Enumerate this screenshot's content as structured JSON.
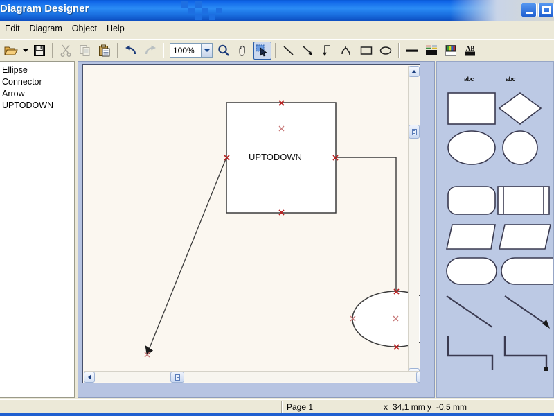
{
  "window": {
    "title": "Diagram Designer",
    "buttons": [
      {
        "name": "minimize",
        "glyph": "minimize-icon"
      },
      {
        "name": "maximize",
        "glyph": "maximize-icon"
      }
    ]
  },
  "menubar": {
    "items": [
      {
        "label": "Edit"
      },
      {
        "label": "Diagram"
      },
      {
        "label": "Object"
      },
      {
        "label": "Help"
      }
    ]
  },
  "toolbar": {
    "open_label": "open-folder-icon",
    "open_dropdown_label": "dropdown-arrow-icon",
    "save_label": "save-icon",
    "cut_label": "cut-icon",
    "copy_label": "copy-icon",
    "paste_label": "paste-icon",
    "undo_label": "undo-icon",
    "redo_label": "redo-icon",
    "zoom": {
      "value": "100%",
      "placeholder": "100%"
    },
    "magnifier_label": "magnifier-icon",
    "pan_label": "hand-icon",
    "select_label": "select-pointer-icon",
    "line_label": "line-icon",
    "arrow_label": "arrow-icon",
    "elbow_label": "elbow-connector-icon",
    "polyline_label": "polyline-connector-icon",
    "rect_label": "rectangle-icon",
    "ellipse_label": "ellipse-icon",
    "linewidth_label": "line-width-icon",
    "linestyle_label": "line-style-icon",
    "fillcolor_label": "fill-color-icon",
    "font_label": "font-icon"
  },
  "object_list": {
    "items": [
      {
        "label": "Ellipse"
      },
      {
        "label": "Connector"
      },
      {
        "label": "Arrow"
      },
      {
        "label": "UPTODOWN"
      }
    ]
  },
  "canvas": {
    "shapes": {
      "rectangle_label": "UPTODOWN"
    },
    "vscroll": {
      "up_label": "scroll-up-icon",
      "down_label": "scroll-down-icon"
    },
    "hscroll": {
      "left_label": "scroll-left-icon",
      "right_label": "scroll-right-icon"
    }
  },
  "palette": {
    "text_labels": [
      {
        "label": "abc"
      },
      {
        "label": "abc"
      }
    ],
    "shapes": [
      {
        "name": "rectangle"
      },
      {
        "name": "diamond"
      },
      {
        "name": "ellipse"
      },
      {
        "name": "circle"
      },
      {
        "name": "rounded-rectangle"
      },
      {
        "name": "predefined-process"
      },
      {
        "name": "trapezoid-down"
      },
      {
        "name": "parallelogram"
      },
      {
        "name": "stadium"
      },
      {
        "name": "delay"
      },
      {
        "name": "line"
      },
      {
        "name": "arrow"
      },
      {
        "name": "elbow-connector"
      },
      {
        "name": "elbow-arrow-connector"
      }
    ]
  },
  "statusbar": {
    "page": "Page 1",
    "coordinates": "x=34,1 mm  y=-0,5 mm"
  },
  "colors": {
    "titlebar_blue": "#1066e8",
    "toolbar_bg": "#ece9d8",
    "canvas_bg": "#fbf7f0",
    "palette_bg": "#bcc9e4",
    "handle_red": "#c00000",
    "shape_stroke": "#3a3a3a"
  }
}
